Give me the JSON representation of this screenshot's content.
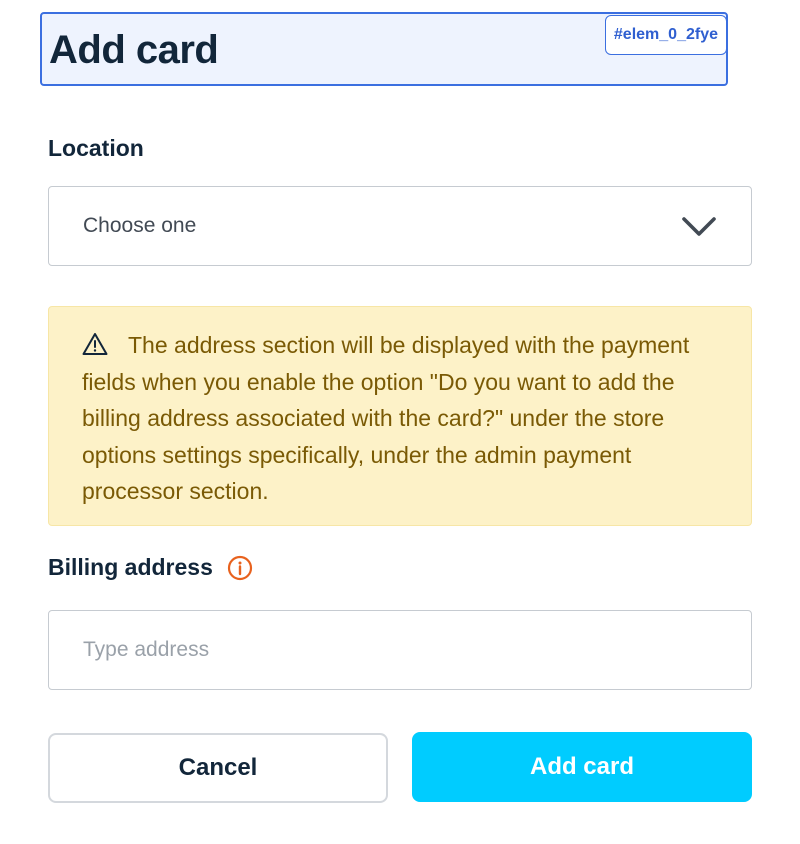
{
  "dialog": {
    "title": "Add card",
    "element_tag": "#elem_0_2fye"
  },
  "location": {
    "label": "Location",
    "selected": "Choose one",
    "icon": "chevron-down-icon"
  },
  "alert": {
    "icon": "warning-icon",
    "text": "The address section will be displayed with the payment fields when you enable the option \"Do you want to add the billing address associated with the card?\" under the store options settings specifically, under the admin payment processor section.",
    "background_color": "#fdf2c8",
    "text_color": "#7a5a05"
  },
  "billing": {
    "label": "Billing address",
    "info_icon": "info-icon",
    "info_icon_color": "#e8621e",
    "placeholder": "Type address",
    "value": ""
  },
  "actions": {
    "cancel_label": "Cancel",
    "add_label": "Add card",
    "accent_color": "#00ccff"
  }
}
